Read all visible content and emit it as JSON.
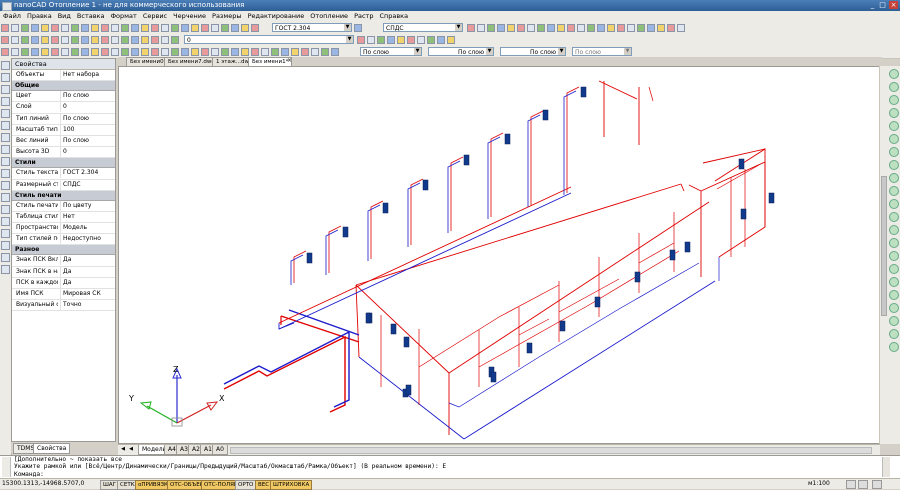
{
  "window": {
    "title": "nanoCAD Отопление 1 - не для коммерческого использования",
    "controls": [
      "_",
      "□",
      "×"
    ]
  },
  "menu": [
    "Файл",
    "Правка",
    "Вид",
    "Вставка",
    "Формат",
    "Сервис",
    "Черчение",
    "Размеры",
    "Редактирование",
    "Отопление",
    "Растр",
    "Справка"
  ],
  "toolbar": {
    "text_style": "ГОСТ 2.304",
    "dim_style": "СПДС",
    "layer": "0",
    "color": "По слою",
    "linetype": "По слою",
    "lineweight": "По слою",
    "plotstyle": "По слою"
  },
  "properties": {
    "header": "Свойства",
    "selection_key": "Объекты",
    "selection_value": "Нет набора",
    "sections": [
      {
        "title": "Общие",
        "rows": [
          [
            "Цвет",
            "По слою"
          ],
          [
            "Слой",
            "0"
          ],
          [
            "Тип линий",
            "По слою"
          ],
          [
            "Масштаб типа",
            "100"
          ],
          [
            "Вес линий",
            "По слою"
          ],
          [
            "Высота 3D",
            "0"
          ]
        ]
      },
      {
        "title": "Стили",
        "rows": [
          [
            "Стиль текста",
            "ГОСТ 2.304"
          ],
          [
            "Размерный ст...",
            "СПДС"
          ]
        ]
      },
      {
        "title": "Стиль печати",
        "rows": [
          [
            "Стиль печати",
            "По цвету"
          ],
          [
            "Таблица стиле...",
            "Нет"
          ],
          [
            "Пространство ...",
            "Модель"
          ],
          [
            "Тип стилей печ...",
            "Недоступно"
          ]
        ]
      },
      {
        "title": "Разное",
        "rows": [
          [
            "Знак ПСК Вкл",
            "Да"
          ],
          [
            "Знак ПСК в на...",
            "Да"
          ],
          [
            "ПСК в каждом ...",
            "Да"
          ],
          [
            "Имя ПСК",
            "Мировая СК"
          ],
          [
            "Визуальный ст...",
            "Точно"
          ]
        ]
      }
    ]
  },
  "panel_tabs": [
    "TDMS",
    "Свойства"
  ],
  "doc_tabs": [
    "Без имени0*",
    "Без имени7.dwg",
    "1 этаж...dwg",
    "Без имени1*"
  ],
  "model_tabs": [
    "Модель",
    "A4",
    "A3",
    "A2",
    "A1",
    "A0"
  ],
  "ucs": {
    "x": "X",
    "y": "Y",
    "z": "Z"
  },
  "command": {
    "line1": "[Дополнительно ~ показать все",
    "line2": "Укажите рамкой или [Всё/Центр/Динамически/Границы/Предыдущий/Масштаб/Окмасштаб/Рамка/Объект] (В реальном времени): E",
    "line3": "Команда:"
  },
  "status": {
    "coords": "15300.1313,-14968.5707,0",
    "buttons": [
      {
        "label": "ШАГ",
        "on": false
      },
      {
        "label": "СЕТКА",
        "on": false
      },
      {
        "label": "оПРИВЯЗКА",
        "on": true
      },
      {
        "label": "ОТС-ОБЪЕКТ",
        "on": true
      },
      {
        "label": "ОТС-ПОЛЯР",
        "on": true
      },
      {
        "label": "ОРТО",
        "on": false
      },
      {
        "label": "ВЕС",
        "on": true
      },
      {
        "label": "ШТРИХОВКА",
        "on": true
      }
    ],
    "zoom": "м1:100"
  },
  "colors": {
    "supply": "#e00000",
    "return": "#1a1acc",
    "radiator": "#123a8c"
  }
}
